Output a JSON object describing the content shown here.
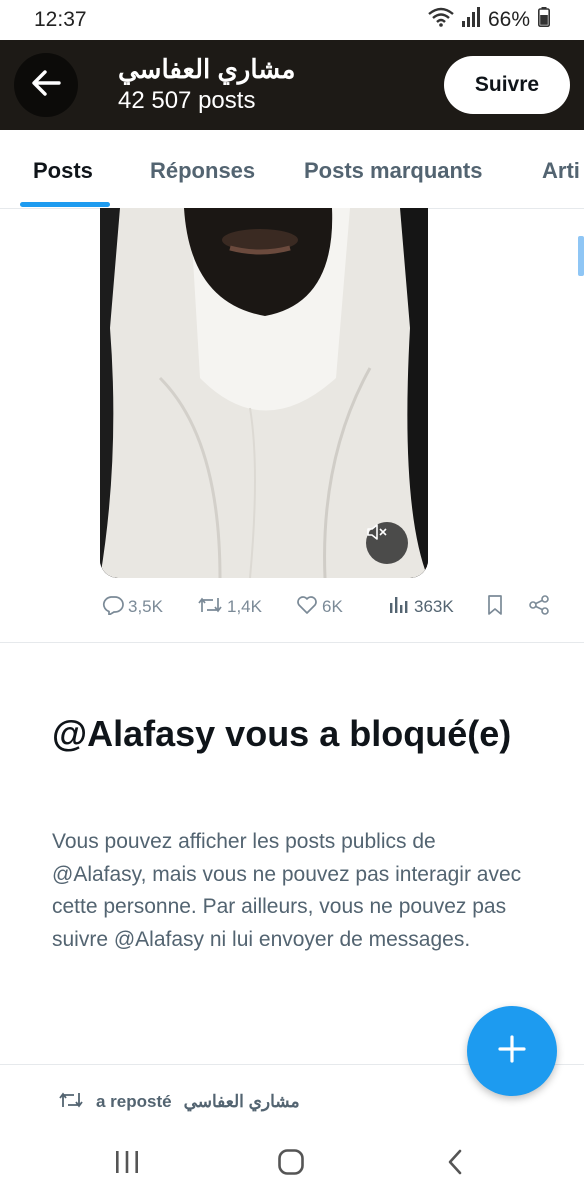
{
  "status_bar": {
    "time": "12:37",
    "battery": "66%"
  },
  "header": {
    "name": "مشاري العفاسي",
    "post_count": "42 507 posts",
    "follow_label": "Suivre"
  },
  "tabs": [
    {
      "label": "Posts",
      "active": true
    },
    {
      "label": "Réponses",
      "active": false
    },
    {
      "label": "Posts marquants",
      "active": false
    },
    {
      "label": "Arti",
      "active": false
    }
  ],
  "post": {
    "replies": "3,5K",
    "reposts": "1,4K",
    "likes": "6K",
    "views": "363K"
  },
  "blocked": {
    "title": "@Alafasy vous a bloqué(e)",
    "message": "Vous pouvez afficher les posts publics de @Alafasy, mais vous ne pouvez pas interagir avec cette personne. Par ailleurs, vous ne pouvez pas suivre @Alafasy ni lui envoyer de messages."
  },
  "repost_banner": {
    "text": "a reposté",
    "name": "مشاري العفاسي"
  },
  "colors": {
    "accent": "#1d9bf0",
    "header_bg": "#1d1a16",
    "text_secondary": "#536471"
  },
  "icons": [
    "back-arrow-icon",
    "mute-icon",
    "reply-icon",
    "repost-icon",
    "like-icon",
    "views-icon",
    "bookmark-icon",
    "share-icon",
    "compose-plus-icon"
  ]
}
